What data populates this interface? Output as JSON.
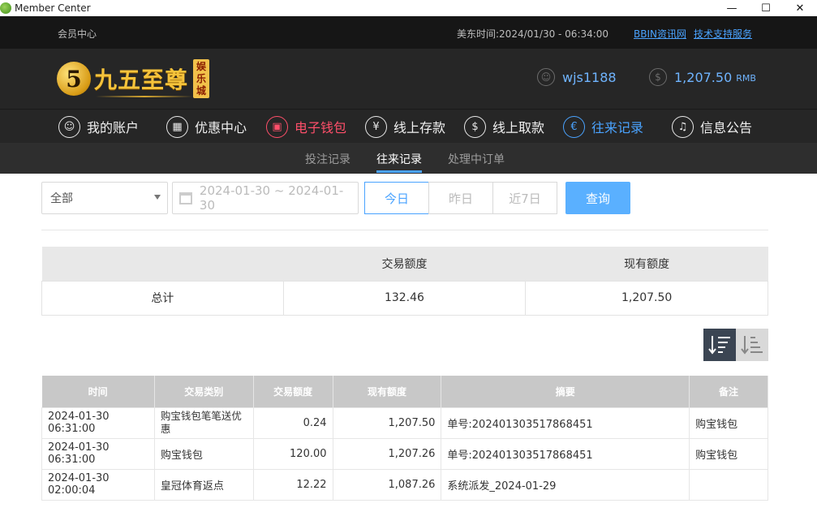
{
  "window": {
    "title": "Member Center",
    "min_icon": "minimize-icon",
    "max_icon": "maximize-icon",
    "close_icon": "close-icon"
  },
  "topbar": {
    "member_center": "会员中心",
    "time_label": "美东时间:",
    "time_value": "2024/01/30 - 06:34:00",
    "link_news": "BBIN资讯网",
    "link_support": "技术支持服务"
  },
  "header": {
    "logo_digit": "5",
    "logo_name": "九五至尊",
    "logo_seal": "娱乐城",
    "username": "wjs1188",
    "balance": "1,207.50",
    "currency": "RMB"
  },
  "nav": [
    {
      "label": "我的账户",
      "icon": "user-icon",
      "glyph": "☺"
    },
    {
      "label": "优惠中心",
      "icon": "gift-icon",
      "glyph": "▦"
    },
    {
      "label": "电子钱包",
      "icon": "wallet-icon",
      "glyph": "▣"
    },
    {
      "label": "线上存款",
      "icon": "deposit-icon",
      "glyph": "¥"
    },
    {
      "label": "线上取款",
      "icon": "withdraw-icon",
      "glyph": "$"
    },
    {
      "label": "往来记录",
      "icon": "record-icon",
      "glyph": "€"
    },
    {
      "label": "信息公告",
      "icon": "bell-icon",
      "glyph": "♫"
    }
  ],
  "subnav": [
    "投注记录",
    "往来记录",
    "处理中订单"
  ],
  "filter": {
    "category": "全部",
    "date_range": "2024-01-30 ~ 2024-01-30",
    "quick": [
      "今日",
      "昨日",
      "近7日"
    ],
    "query": "查询"
  },
  "summary": {
    "headers": [
      "",
      "交易额度",
      "现有额度"
    ],
    "row": [
      "总计",
      "132.46",
      "1,207.50"
    ]
  },
  "table": {
    "headers": [
      "时间",
      "交易类别",
      "交易额度",
      "现有额度",
      "摘要",
      "备注"
    ],
    "rows": [
      [
        "2024-01-30 06:31:00",
        "购宝钱包笔笔送优惠",
        "0.24",
        "1,207.50",
        "单号:202401303517868451",
        "购宝钱包"
      ],
      [
        "2024-01-30 06:31:00",
        "购宝钱包",
        "120.00",
        "1,207.26",
        "单号:202401303517868451",
        "购宝钱包"
      ],
      [
        "2024-01-30 02:00:04",
        "皇冠体育返点",
        "12.22",
        "1,087.26",
        "系统派发_2024-01-29",
        ""
      ]
    ]
  },
  "colors": {
    "accent": "#4aa3ff",
    "active_red": "#ff4f6a",
    "dark_bg": "#262626",
    "query_bg": "#5ab0ff"
  }
}
